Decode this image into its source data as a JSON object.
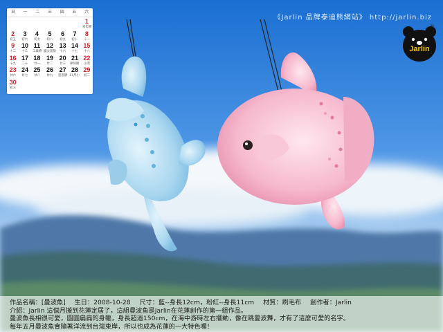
{
  "header": {
    "watermark": "《Jarlin 品牌泰迪熊網站》 http://jarlin.biz",
    "logo_text": "Jarlin",
    "logo_mark": "®"
  },
  "calendar": {
    "weekdays": [
      "日",
      "一",
      "二",
      "三",
      "四",
      "五",
      "六"
    ],
    "days": [
      {
        "n": "",
        "l": ""
      },
      {
        "n": "",
        "l": ""
      },
      {
        "n": "",
        "l": ""
      },
      {
        "n": "",
        "l": ""
      },
      {
        "n": "",
        "l": ""
      },
      {
        "n": "",
        "l": ""
      },
      {
        "n": "1",
        "l": "青年節"
      },
      {
        "n": "2",
        "l": "初五"
      },
      {
        "n": "3",
        "l": "初六"
      },
      {
        "n": "4",
        "l": "初七"
      },
      {
        "n": "5",
        "l": "初八"
      },
      {
        "n": "6",
        "l": "初九"
      },
      {
        "n": "7",
        "l": "初十"
      },
      {
        "n": "8",
        "l": "十一"
      },
      {
        "n": "9",
        "l": "十二"
      },
      {
        "n": "10",
        "l": "十三"
      },
      {
        "n": "11",
        "l": "工業節"
      },
      {
        "n": "12",
        "l": "國父誕辰"
      },
      {
        "n": "13",
        "l": "十六"
      },
      {
        "n": "14",
        "l": "十七"
      },
      {
        "n": "15",
        "l": "十八"
      },
      {
        "n": "16",
        "l": "十九"
      },
      {
        "n": "17",
        "l": "二十"
      },
      {
        "n": "18",
        "l": "廿一"
      },
      {
        "n": "19",
        "l": "廿二"
      },
      {
        "n": "20",
        "l": "廿三"
      },
      {
        "n": "21",
        "l": "律師節"
      },
      {
        "n": "22",
        "l": "小雪"
      },
      {
        "n": "23",
        "l": "廿六"
      },
      {
        "n": "24",
        "l": "廿七"
      },
      {
        "n": "25",
        "l": "廿八"
      },
      {
        "n": "26",
        "l": "廿九"
      },
      {
        "n": "27",
        "l": "感恩節"
      },
      {
        "n": "28",
        "l": "11月小"
      },
      {
        "n": "29",
        "l": "初二"
      },
      {
        "n": "30",
        "l": "初三"
      }
    ]
  },
  "info": {
    "name": "作品名稱：[曼波魚]",
    "birthday": "生日：2008-10-28",
    "size": "尺寸：藍--身長12cm，粉紅--身長11cm",
    "material": "材質：刷毛布",
    "creator": "創作者：Jarlin",
    "intro": "介紹：Jarlin 這個月搬到花蓮定居了，這組曼波魚是Jarlin在花蓮創作的第一組作品。",
    "line3": "曼波魚長相很可愛，圓圓扁扁的身軀，身長超過150cm，在海中游時左右擺動，像在跳曼波舞，才有了這麼可愛的名字。",
    "line4": "每年五月曼波魚會隨著洋流到台灣東岸，所以也成為花蓮的一大特色喔！"
  }
}
